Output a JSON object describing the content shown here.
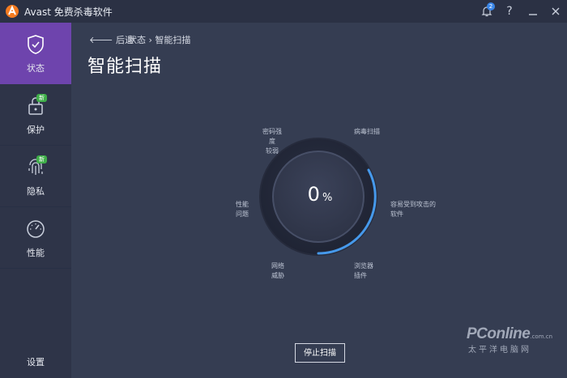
{
  "window": {
    "title": "Avast 免费杀毒软件",
    "notification_count": "2"
  },
  "sidebar": {
    "items": [
      {
        "label": "状态",
        "icon": "shield-check-icon",
        "badge": ""
      },
      {
        "label": "保护",
        "icon": "lock-icon",
        "badge": "新"
      },
      {
        "label": "隐私",
        "icon": "fingerprint-icon",
        "badge": "新"
      },
      {
        "label": "性能",
        "icon": "speedometer-icon",
        "badge": ""
      }
    ],
    "settings_label": "设置"
  },
  "breadcrumb": {
    "back_label": "后退",
    "path": "状态 › 智能扫描"
  },
  "page_title": "智能扫描",
  "scan": {
    "progress_value": "0",
    "progress_unit": "%",
    "progress_fraction": 0,
    "categories": {
      "password": "密码强度\n较弱",
      "virus": "病毒扫描",
      "vulnerable_software": "容易受到攻击的\n软件",
      "browser_addons": "浏览器\n插件",
      "network_threats": "网络\n威胁",
      "performance_issues": "性能\n问题"
    }
  },
  "stop_button_label": "停止扫描",
  "watermark": {
    "main": "PConline",
    "domain": ".com.cn",
    "sub": "太平洋电脑网"
  },
  "colors": {
    "accent_purple": "#6e44ad",
    "ring_blue": "#4aa6ff",
    "badge_green": "#3fae49",
    "background": "#353d52"
  }
}
